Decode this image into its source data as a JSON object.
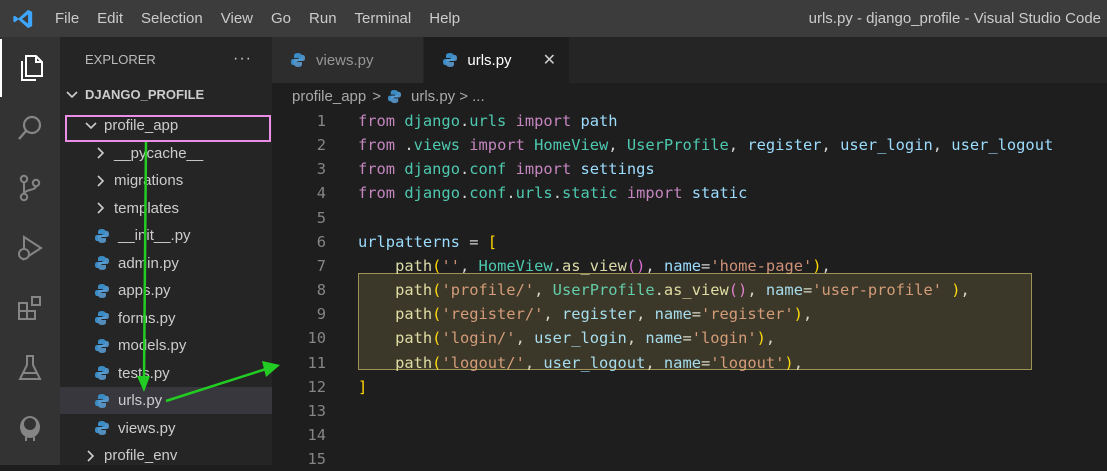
{
  "menu": [
    "File",
    "Edit",
    "Selection",
    "View",
    "Go",
    "Run",
    "Terminal",
    "Help"
  ],
  "window_title": "urls.py - django_profile - Visual Studio Code",
  "activity_bar": [
    "explorer-icon",
    "search-icon",
    "source-control-icon",
    "run-debug-icon",
    "extensions-icon",
    "testing-icon",
    "database-icon"
  ],
  "sidebar": {
    "header": "EXPLORER",
    "more": "···",
    "root": "DJANGO_PROFILE",
    "items": [
      {
        "label": "profile_app",
        "type": "folder-open"
      },
      {
        "label": "__pycache__",
        "type": "folder"
      },
      {
        "label": "migrations",
        "type": "folder"
      },
      {
        "label": "templates",
        "type": "folder"
      },
      {
        "label": "__init__.py",
        "type": "py"
      },
      {
        "label": "admin.py",
        "type": "py"
      },
      {
        "label": "apps.py",
        "type": "py"
      },
      {
        "label": "forms.py",
        "type": "py"
      },
      {
        "label": "models.py",
        "type": "py"
      },
      {
        "label": "tests.py",
        "type": "py"
      },
      {
        "label": "urls.py",
        "type": "py"
      },
      {
        "label": "views.py",
        "type": "py"
      },
      {
        "label": "profile_env",
        "type": "folder"
      }
    ]
  },
  "tabs": [
    {
      "label": "views.py",
      "active": false
    },
    {
      "label": "urls.py",
      "active": true,
      "close": "✕"
    }
  ],
  "breadcrumb": {
    "folder": "profile_app",
    "sep": ">",
    "file": "urls.py",
    "tail": "> ..."
  },
  "line_numbers": [
    "1",
    "2",
    "3",
    "4",
    "5",
    "6",
    "7",
    "8",
    "9",
    "10",
    "11",
    "12",
    "13",
    "14",
    "15"
  ],
  "code_lines": [
    "from django.urls import path",
    "from .views import HomeView, UserProfile, register, user_login, user_logout",
    "from django.conf import settings",
    "from django.conf.urls.static import static",
    "",
    "urlpatterns = [",
    "    path('', HomeView.as_view(), name='home-page'),",
    "    path('profile/', UserProfile.as_view(), name='user-profile' ),",
    "    path('register/', register, name='register'),",
    "    path('login/', user_login, name='login'),",
    "    path('logout/', user_logout, name='logout'),",
    "]",
    "",
    "",
    ""
  ],
  "colors": {
    "accent": "#007acc",
    "annotation_box": "#e98de6",
    "annotation_arrow": "#22cc22",
    "highlight": "#f0dc78"
  }
}
